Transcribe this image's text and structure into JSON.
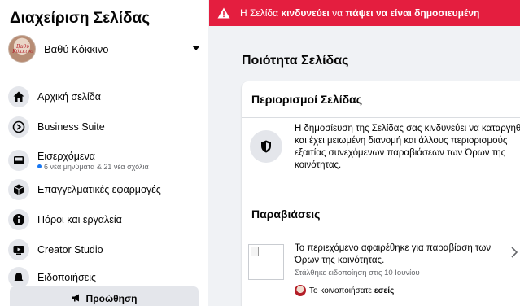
{
  "sidebar": {
    "title": "Διαχείριση Σελίδας",
    "page_name": "Βαθύ Κόκκινο",
    "avatar_text": "Βαθύ Κόκκινο",
    "items": [
      {
        "label": "Αρχική σελίδα",
        "icon": "home-icon"
      },
      {
        "label": "Business Suite",
        "icon": "business-suite-icon"
      },
      {
        "label": "Εισερχόμενα",
        "icon": "inbox-icon",
        "sub": "6 νέα μηνύματα & 21 νέα σχόλια"
      },
      {
        "label": "Επαγγελματικές εφαρμογές",
        "icon": "cube-icon"
      },
      {
        "label": "Πόροι και εργαλεία",
        "icon": "info-icon"
      },
      {
        "label": "Creator Studio",
        "icon": "creator-studio-icon"
      },
      {
        "label": "Ειδοποιήσεις",
        "icon": "notifications-icon"
      }
    ],
    "promote_label": "Προώθηση"
  },
  "alert": {
    "text_prefix": "Η Σελίδα ",
    "text_bold1": "κινδυνεύει",
    "text_mid": " να ",
    "text_bold2": "πάψει να είναι δημοσιευμένη",
    "color": "#e41e3f"
  },
  "main": {
    "title": "Ποιότητα Σελίδας",
    "restrictions_heading": "Περιορισμοί Σελίδας",
    "restrictions_text": "Η δημοσίευση της Σελίδας σας κινδυνεύει να καταργηθεί και έχει μειωμένη διανομή και άλλους περιορισμούς εξαιτίας συνεχόμενων παραβιάσεων των Όρων της κοινότητας.",
    "violations_heading": "Παραβιάσεις",
    "violation": {
      "text": "Το περιεχόμενο αφαιρέθηκε για παραβίαση των Όρων της κοινότητας.",
      "meta": "Στάλθηκε ειδοποίηση στις 10 Ιουνίου",
      "shared_prefix": "Το κοινοποιήσατε ",
      "shared_bold": "εσείς"
    }
  }
}
